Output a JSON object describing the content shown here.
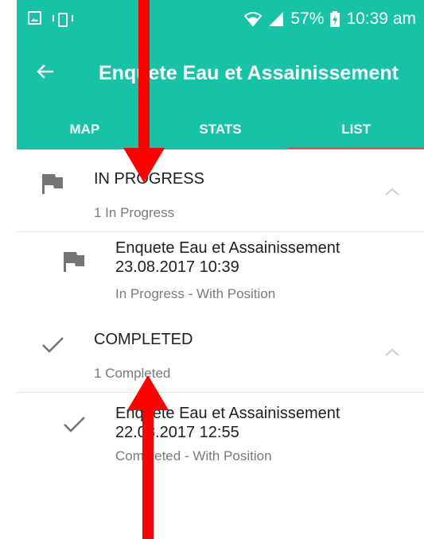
{
  "status_bar": {
    "battery": "57%",
    "time": "10:39 am",
    "icons": [
      "image-icon",
      "vibrate-icon",
      "wifi-icon",
      "signal-icon",
      "battery-icon"
    ]
  },
  "app_bar": {
    "title": "Enquete Eau et Assainissement",
    "back_icon": "arrow-left-icon",
    "tabs": [
      {
        "label": "MAP",
        "selected": false
      },
      {
        "label": "STATS",
        "selected": false
      },
      {
        "label": "LIST",
        "selected": true
      }
    ]
  },
  "groups": [
    {
      "title": "IN PROGRESS",
      "count": "1 In Progress",
      "icon": "flag-icon",
      "expanded": true,
      "items": [
        {
          "title": "Enquete Eau et Assainissement 23.08.2017 10:39",
          "subtitle": "In Progress - With Position",
          "icon": "flag-icon"
        }
      ]
    },
    {
      "title": "COMPLETED",
      "count": "1 Completed",
      "icon": "check-icon",
      "expanded": true,
      "items": [
        {
          "title": "Enquete Eau et Assainissement 22.08.2017 12:55",
          "subtitle": "Completed - With Position",
          "icon": "check-icon"
        }
      ]
    }
  ],
  "colors": {
    "primary": "#17c2a6",
    "tab_indicator": "#e8505b",
    "annotation": "#ff0000",
    "icon_gray": "#757575",
    "subtext_gray": "#7a7a7a"
  }
}
